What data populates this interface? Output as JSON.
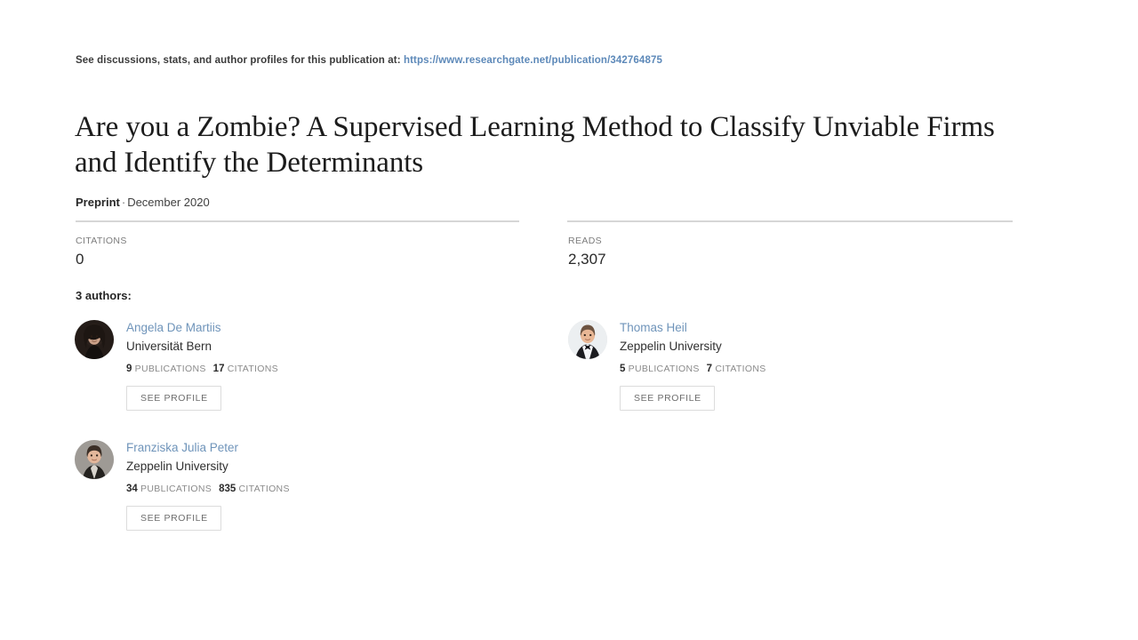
{
  "source": {
    "prefix": "See discussions, stats, and author profiles for this publication at:",
    "url": "https://www.researchgate.net/publication/342764875",
    "link_color": "#5d89b9"
  },
  "publication": {
    "title": "Are you a Zombie? A Supervised Learning Method to Classify Unviable Firms and Identify the Determinants",
    "type": "Preprint",
    "separator": "·",
    "date": "December 2020"
  },
  "stats": [
    {
      "label": "CITATIONS",
      "value": "0"
    },
    {
      "label": "READS",
      "value": "2,307"
    }
  ],
  "authors_section": {
    "count_label": "3 authors:",
    "see_profile_label": "SEE PROFILE",
    "publications_label": "PUBLICATIONS",
    "citations_label": "CITATIONS"
  },
  "authors": [
    {
      "name": "Angela De Martiis",
      "affiliation": "Universität Bern",
      "publications": "9",
      "citations": "17",
      "avatar": "avatar-woman-dark-hair"
    },
    {
      "name": "Thomas Heil",
      "affiliation": "Zeppelin University",
      "publications": "5",
      "citations": "7",
      "avatar": "avatar-man-tuxedo"
    },
    {
      "name": "Franziska Julia Peter",
      "affiliation": "Zeppelin University",
      "publications": "34",
      "citations": "835",
      "avatar": "avatar-woman-grey-background"
    }
  ]
}
